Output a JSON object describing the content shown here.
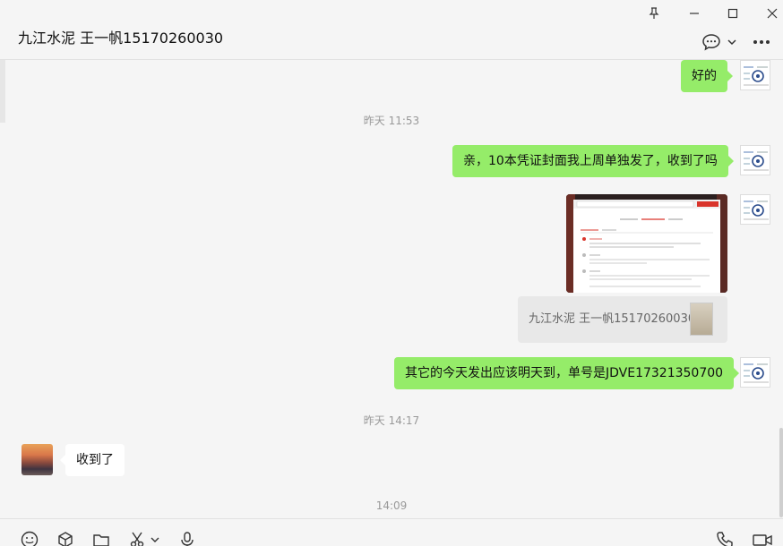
{
  "window": {
    "title": "九江水泥 王一帆15170260030",
    "pin_icon": "pin-icon",
    "minimize_icon": "minimize-icon",
    "maximize_icon": "maximize-icon",
    "close_icon": "close-icon",
    "chat_info_icon": "chat-bubble-icon",
    "chevron_icon": "chevron-down-icon",
    "more_icon": "more-icon"
  },
  "messages": [
    {
      "kind": "text",
      "from": "me",
      "text": "好的"
    },
    {
      "kind": "timestamp",
      "text": "昨天 11:53"
    },
    {
      "kind": "text",
      "from": "me",
      "text": "亲，10本凭证封面我上周单独发了，收到了吗"
    },
    {
      "kind": "image",
      "from": "me",
      "image": "screenshot-image"
    },
    {
      "kind": "quote",
      "text": "九江水泥 王一帆15170260030:"
    },
    {
      "kind": "text",
      "from": "me",
      "text": "其它的今天发出应该明天到，单号是JDVE17321350700"
    },
    {
      "kind": "timestamp",
      "text": "昨天 14:17"
    },
    {
      "kind": "text",
      "from": "other",
      "text": "收到了"
    },
    {
      "kind": "timestamp",
      "text": "14:09"
    }
  ],
  "toolbar": {
    "emoji_icon": "emoji-icon",
    "favorites_icon": "box-icon",
    "file_icon": "folder-icon",
    "screenshot_icon": "scissors-icon",
    "voice_icon": "microphone-icon",
    "call_icon": "phone-icon",
    "video_icon": "video-icon"
  },
  "colors": {
    "my_bubble": "#95ec69",
    "other_bubble": "#ffffff",
    "background": "#f5f5f5",
    "timestamp": "#999999"
  }
}
